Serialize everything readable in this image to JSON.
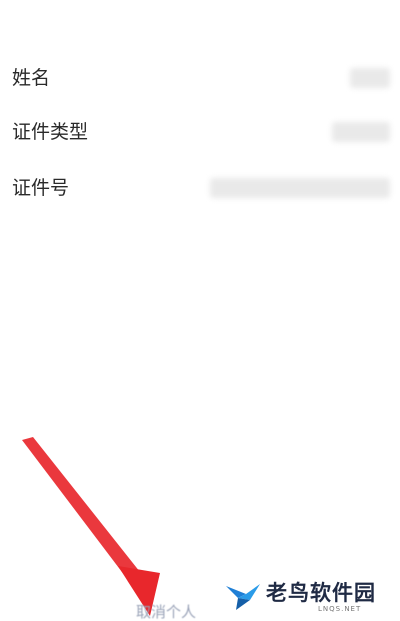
{
  "info_rows": [
    {
      "label": "姓名"
    },
    {
      "label": "证件类型"
    },
    {
      "label": "证件号"
    }
  ],
  "footer": {
    "link_text": "取消个人"
  },
  "watermark": {
    "name": "老鸟软件园",
    "domain": "LNQS.NET"
  },
  "colors": {
    "arrow": "#e8272c",
    "link": "#9aa3b8",
    "watermark_bird": "#1f7fd6"
  },
  "icons": {
    "arrow": "red-arrow-icon",
    "logo": "bird-logo-icon"
  }
}
